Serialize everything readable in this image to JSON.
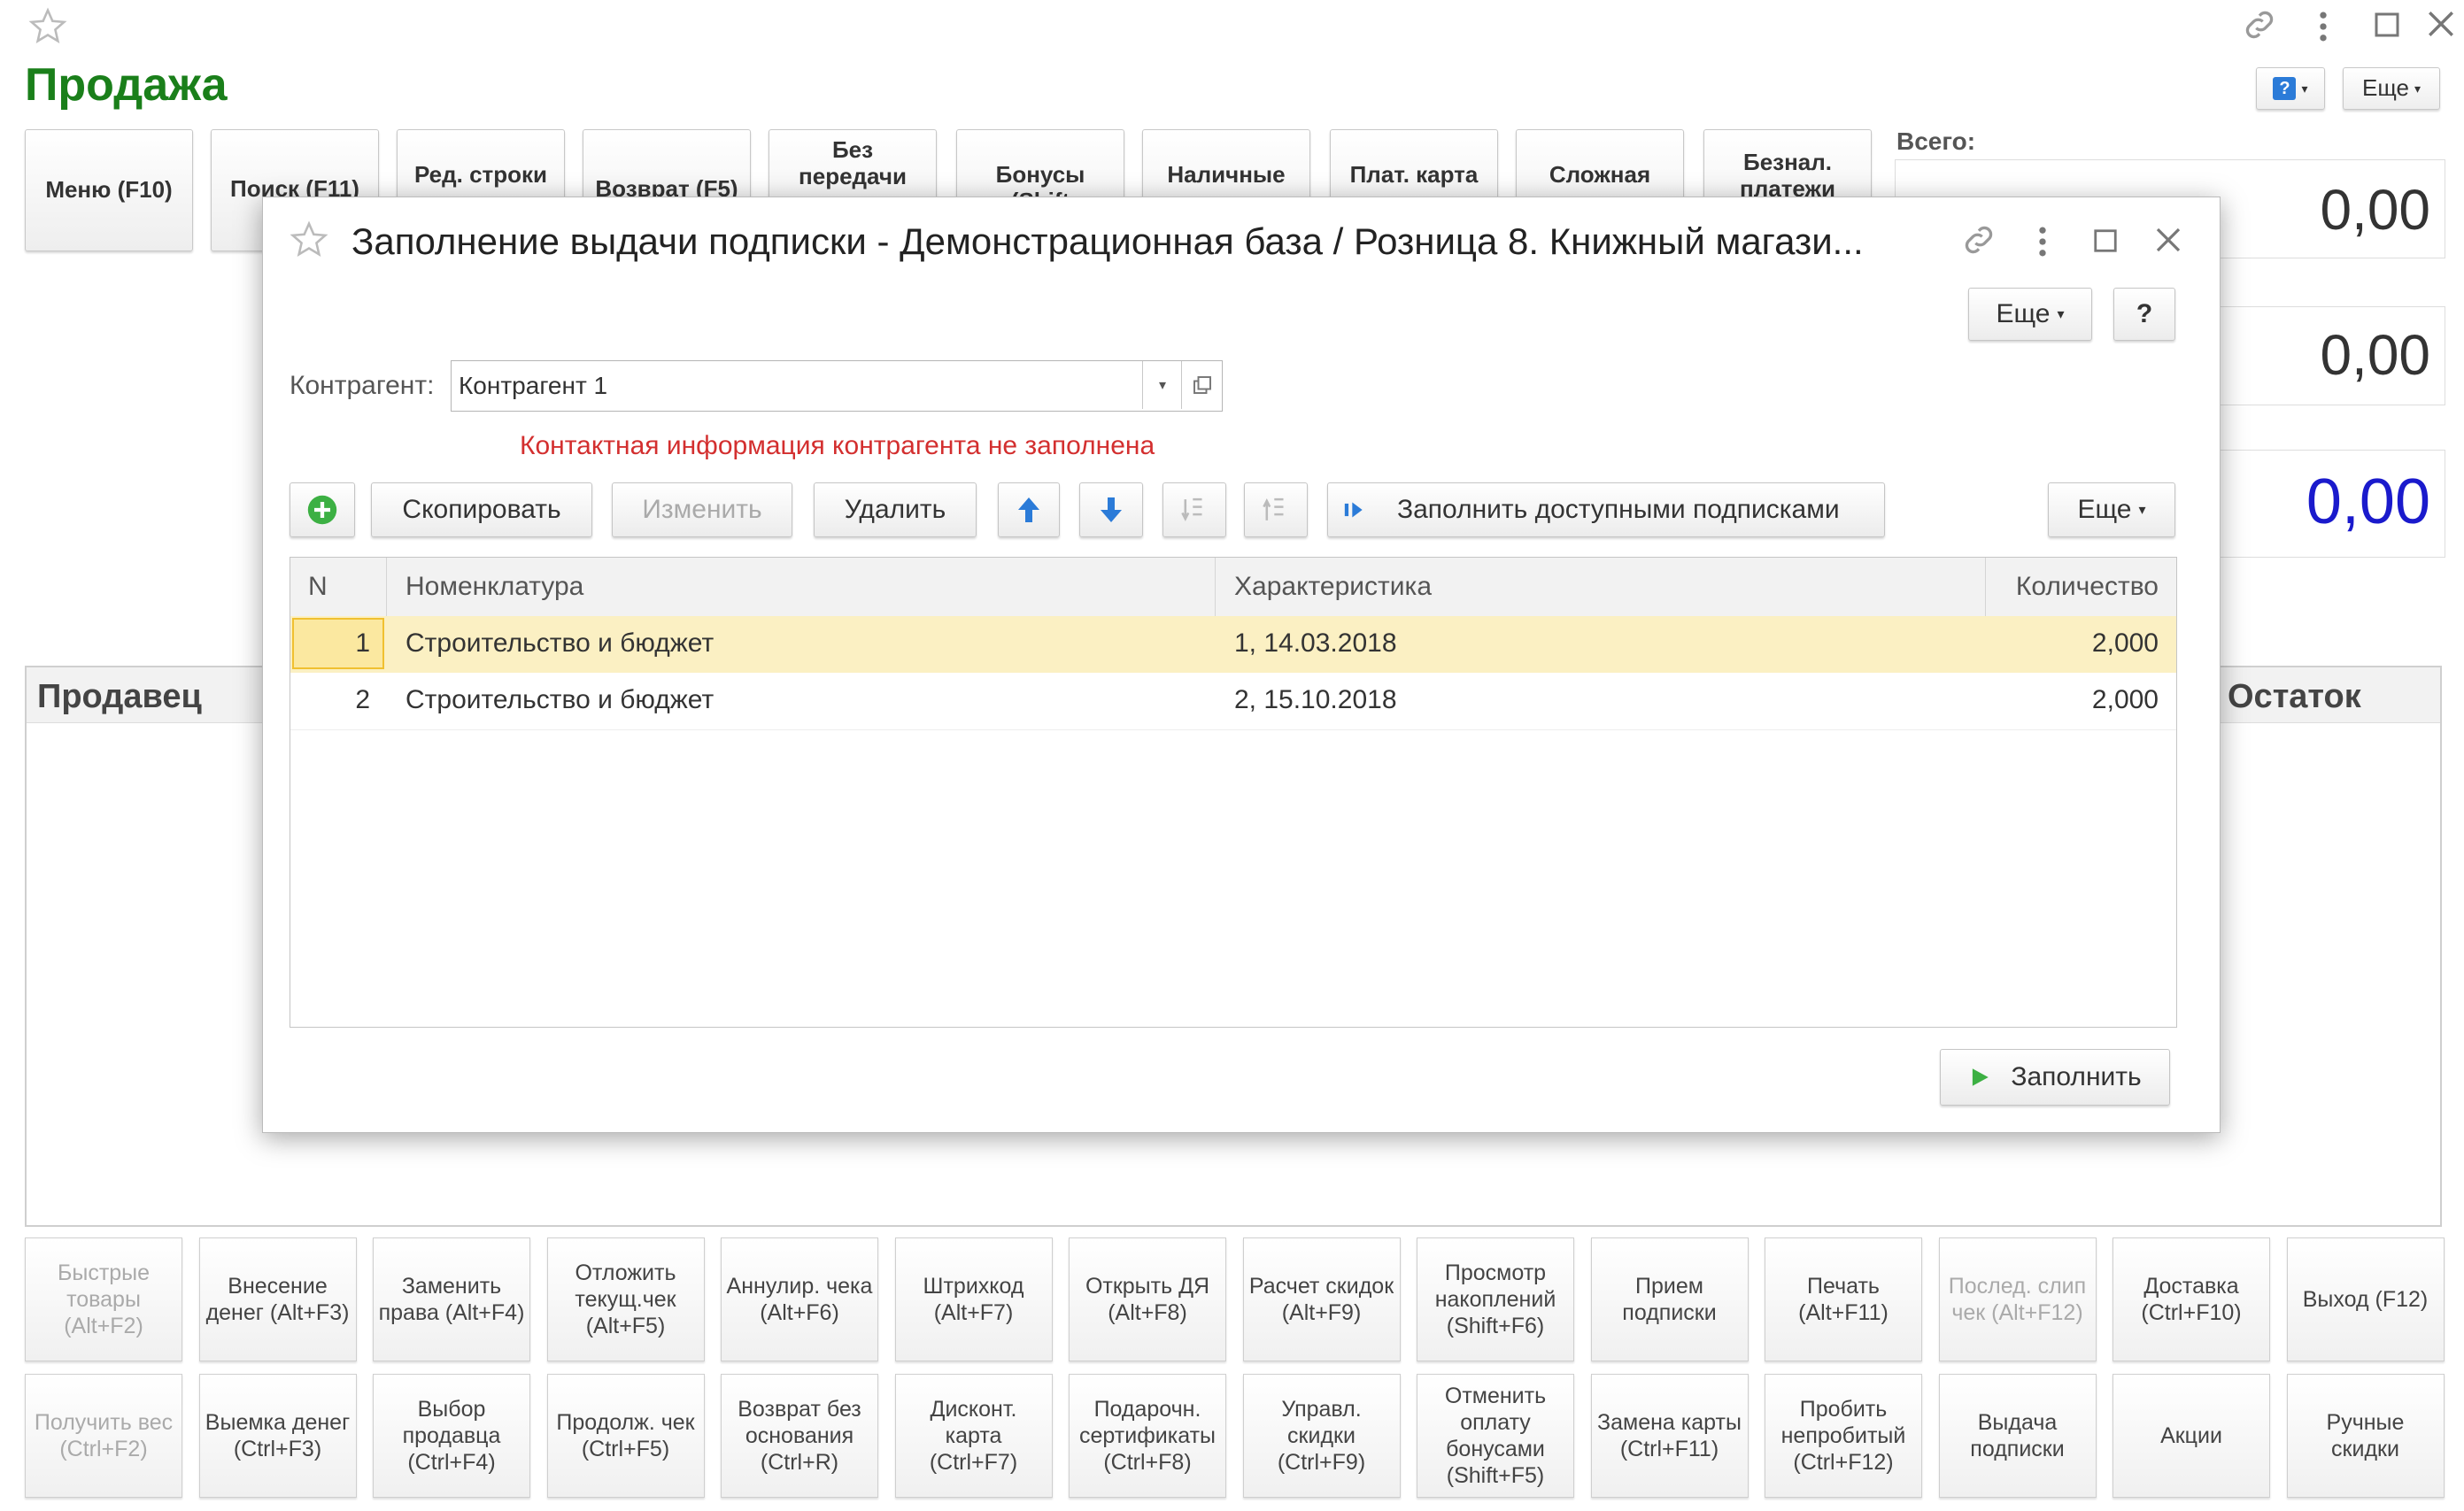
{
  "window": {
    "title": "Продажа",
    "help_button": "?",
    "more_button": "Еще"
  },
  "top_buttons": [
    {
      "label": "Меню (F10)"
    },
    {
      "label": "Поиск (F11)"
    },
    {
      "label": "Ред. строки"
    },
    {
      "label": "Возврат (F5)"
    },
    {
      "label": "Без передачи"
    },
    {
      "label": "Бонусы (Shift"
    },
    {
      "label": "Наличные"
    },
    {
      "label": "Плат. карта"
    },
    {
      "label": "Сложная"
    },
    {
      "label": "Безнал. платежи"
    }
  ],
  "totals": {
    "label": "Всего:",
    "values": [
      "0,00",
      "0,00",
      "0,00"
    ],
    "highlight_color": "#1a1acc"
  },
  "panel": {
    "left_title": "Продавец",
    "right_title": "Остаток"
  },
  "function_keys_row1": [
    {
      "label": "Быстрые товары (Alt+F2)",
      "disabled": true
    },
    {
      "label": "Внесение денег (Alt+F3)",
      "disabled": false
    },
    {
      "label": "Заменить права (Alt+F4)",
      "disabled": false
    },
    {
      "label": "Отложить текущ.чек (Alt+F5)",
      "disabled": false
    },
    {
      "label": "Аннулир. чека (Alt+F6)",
      "disabled": false
    },
    {
      "label": "Штрихкод (Alt+F7)",
      "disabled": false
    },
    {
      "label": "Открыть ДЯ (Alt+F8)",
      "disabled": false
    },
    {
      "label": "Расчет скидок (Alt+F9)",
      "disabled": false
    },
    {
      "label": "Просмотр накоплений (Shift+F6)",
      "disabled": false
    },
    {
      "label": "Прием подписки",
      "disabled": false
    },
    {
      "label": "Печать (Alt+F11)",
      "disabled": false
    },
    {
      "label": "Послед. слип чек (Alt+F12)",
      "disabled": true
    },
    {
      "label": "Доставка (Ctrl+F10)",
      "disabled": false
    },
    {
      "label": "Выход (F12)",
      "disabled": false
    }
  ],
  "function_keys_row2": [
    {
      "label": "Получить вес (Ctrl+F2)",
      "disabled": true
    },
    {
      "label": "Выемка денег (Ctrl+F3)",
      "disabled": false
    },
    {
      "label": "Выбор продавца (Ctrl+F4)",
      "disabled": false
    },
    {
      "label": "Продолж. чек (Ctrl+F5)",
      "disabled": false
    },
    {
      "label": "Возврат без основания (Ctrl+R)",
      "disabled": false
    },
    {
      "label": "Дисконт. карта (Ctrl+F7)",
      "disabled": false
    },
    {
      "label": "Подарочн. сертификаты (Ctrl+F8)",
      "disabled": false
    },
    {
      "label": "Управл. скидки (Ctrl+F9)",
      "disabled": false
    },
    {
      "label": "Отменить оплату бонусами (Shift+F5)",
      "disabled": false
    },
    {
      "label": "Замена карты (Ctrl+F11)",
      "disabled": false
    },
    {
      "label": "Пробить непробитый (Ctrl+F12)",
      "disabled": false
    },
    {
      "label": "Выдача подписки",
      "disabled": false
    },
    {
      "label": "Акции",
      "disabled": false
    },
    {
      "label": "Ручные скидки",
      "disabled": false
    }
  ],
  "modal": {
    "title": "Заполнение выдачи подписки - Демонстрационная база / Розница 8. Книжный магази...",
    "more_button": "Еще",
    "help_button": "?",
    "counterparty_label": "Контрагент:",
    "counterparty_value": "Контрагент 1",
    "warning": "Контактная информация контрагента не заполнена",
    "toolbar": {
      "copy": "Скопировать",
      "edit": "Изменить",
      "delete": "Удалить",
      "fill_available": "Заполнить доступными подписками",
      "more": "Еще"
    },
    "table": {
      "columns": [
        "N",
        "Номенклатура",
        "Характеристика",
        "Количество"
      ],
      "rows": [
        {
          "n": "1",
          "item": "Строительство и бюджет",
          "characteristic": "1, 14.03.2018",
          "qty": "2,000",
          "selected": true
        },
        {
          "n": "2",
          "item": "Строительство и бюджет",
          "characteristic": "2, 15.10.2018",
          "qty": "2,000",
          "selected": false
        }
      ]
    },
    "fill_button": "Заполнить"
  },
  "colors": {
    "title_green": "#1a7f1a",
    "selected_row": "#fbf0c3",
    "warning_red": "#d32f2f",
    "arrow_blue": "#2b7bd8"
  }
}
